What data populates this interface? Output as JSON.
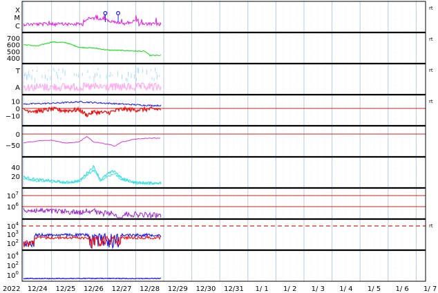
{
  "chart_data": {
    "type": "line",
    "title": "",
    "x_axis": {
      "year_label": "2022",
      "tick_labels": [
        "12/24",
        "12/25",
        "12/26",
        "12/27",
        "12/28",
        "12/29",
        "12/30",
        "12/31",
        "1/ 1",
        "1/ 2",
        "1/ 3",
        "1/ 4",
        "1/ 5",
        "1/ 6",
        "1/ 7"
      ],
      "data_end": "12/28 ~14:00"
    },
    "colors": {
      "magenta": "#e020e0",
      "green": "#22dd22",
      "lightblue": "#aaddff",
      "pink": "#ffaaee",
      "blue": "#1a1ae0",
      "red": "#ee1111",
      "purple": "#dd33dd",
      "cyan": "#22dddd",
      "violet": "#9922cc",
      "threshold": "#cc2222",
      "grid": "#b8c8dc"
    },
    "panels": [
      {
        "id": "xray",
        "y_tick_labels": [
          "X",
          "M",
          "C"
        ],
        "right_mark": "rt",
        "series": [
          {
            "color": "magenta",
            "level": "C",
            "note": "noisy C-level flux, two M-level spikes marked on 12/26 and 12/27"
          }
        ],
        "markers_x": [
          "12/26 ~22:00",
          "12/27 ~09:00"
        ]
      },
      {
        "id": "solar-wind-speed",
        "y_tick_labels": [
          "700",
          "600",
          "500",
          "400"
        ],
        "ylim": [
          350,
          750
        ],
        "right_mark": "rt",
        "series": [
          {
            "color": "green",
            "values_approx": [
              [
                "12/24 00:00",
                600
              ],
              [
                "12/24 12:00",
                580
              ],
              [
                "12/25 00:00",
                640
              ],
              [
                "12/25 12:00",
                630
              ],
              [
                "12/26 00:00",
                560
              ],
              [
                "12/26 12:00",
                550
              ],
              [
                "12/27 00:00",
                520
              ],
              [
                "12/27 12:00",
                515
              ],
              [
                "12/28 00:00",
                505
              ],
              [
                "12/28 08:00",
                500
              ],
              [
                "12/28 12:00",
                440
              ]
            ]
          }
        ]
      },
      {
        "id": "temperature-alpha",
        "y_tick_labels": [
          "T",
          "A"
        ],
        "right_mark": "rt",
        "series": [
          {
            "color": "lightblue",
            "label": "T"
          },
          {
            "color": "pink",
            "label": "A"
          }
        ]
      },
      {
        "id": "imf-components",
        "y_tick_labels": [
          "10",
          "0",
          "−10"
        ],
        "ylim": [
          -20,
          15
        ],
        "right_mark": "rt",
        "reference_line": 0,
        "series": [
          {
            "color": "blue",
            "values_approx": [
              [
                "12/24 00:00",
                6
              ],
              [
                "12/25 00:00",
                7
              ],
              [
                "12/26 00:00",
                9
              ],
              [
                "12/26 12:00",
                8
              ],
              [
                "12/27 00:00",
                7
              ],
              [
                "12/27 12:00",
                6
              ],
              [
                "12/28 00:00",
                5
              ],
              [
                "12/28 12:00",
                4
              ]
            ]
          },
          {
            "color": "red",
            "values_approx": [
              [
                "12/24 00:00",
                -2
              ],
              [
                "12/24 12:00",
                -4
              ],
              [
                "12/25 00:00",
                -1
              ],
              [
                "12/25 12:00",
                -3
              ],
              [
                "12/26 00:00",
                -2
              ],
              [
                "12/26 06:00",
                -9
              ],
              [
                "12/26 12:00",
                -5
              ],
              [
                "12/27 00:00",
                -6
              ],
              [
                "12/27 12:00",
                -1
              ],
              [
                "12/28 00:00",
                -2
              ],
              [
                "12/28 12:00",
                -1
              ]
            ]
          }
        ]
      },
      {
        "id": "dst",
        "y_tick_labels": [
          "0",
          "−50"
        ],
        "ylim": [
          -90,
          25
        ],
        "reference_line": 0,
        "series": [
          {
            "color": "purple",
            "values_approx": [
              [
                "12/24 00:00",
                -40
              ],
              [
                "12/24 12:00",
                -30
              ],
              [
                "12/25 00:00",
                -28
              ],
              [
                "12/25 12:00",
                -40
              ],
              [
                "12/26 00:00",
                -35
              ],
              [
                "12/26 06:00",
                -10
              ],
              [
                "12/26 12:00",
                -35
              ],
              [
                "12/27 00:00",
                -45
              ],
              [
                "12/27 06:00",
                -55
              ],
              [
                "12/27 12:00",
                -35
              ],
              [
                "12/28 00:00",
                -22
              ],
              [
                "12/28 12:00",
                -18
              ]
            ]
          }
        ]
      },
      {
        "id": "proton-density",
        "y_tick_labels": [
          "40",
          "20"
        ],
        "ylim": [
          0,
          60
        ],
        "series": [
          {
            "color": "cyan",
            "values_approx": [
              [
                "12/24 00:00",
                18
              ],
              [
                "12/24 12:00",
                12
              ],
              [
                "12/25 00:00",
                10
              ],
              [
                "12/25 12:00",
                6
              ],
              [
                "12/26 00:00",
                10
              ],
              [
                "12/26 12:00",
                42
              ],
              [
                "12/26 18:00",
                12
              ],
              [
                "12/27 00:00",
                25
              ],
              [
                "12/27 06:00",
                32
              ],
              [
                "12/27 12:00",
                15
              ],
              [
                "12/28 00:00",
                6
              ],
              [
                "12/28 12:00",
                5
              ]
            ]
          }
        ]
      },
      {
        "id": "electron-flux",
        "y_tick_labels": [
          "10",
          "10"
        ],
        "y_tick_exponents": [
          "7",
          "6"
        ],
        "threshold_lines": [
          "1e7",
          "1e6"
        ],
        "series": [
          {
            "color": "violet",
            "note": "around 1e5–1e6, decaying"
          }
        ]
      },
      {
        "id": "proton-flux",
        "y_tick_labels": [
          "10",
          "10",
          "10"
        ],
        "y_tick_exponents": [
          "4",
          "3",
          "2"
        ],
        "right_mark": "rt",
        "dashed_threshold": "1e4",
        "series": [
          {
            "color": "blue",
            "note": "~1e3, dropouts around 12/26"
          },
          {
            "color": "red",
            "note": "~1e3, dropouts around 12/26"
          }
        ]
      },
      {
        "id": "high-energy-flux",
        "y_tick_labels": [
          "10",
          "10",
          "10"
        ],
        "y_tick_exponents": [
          "4",
          "2",
          "0"
        ],
        "series": [
          {
            "color": "blue",
            "note": "flat near 1e-1"
          }
        ]
      }
    ]
  }
}
